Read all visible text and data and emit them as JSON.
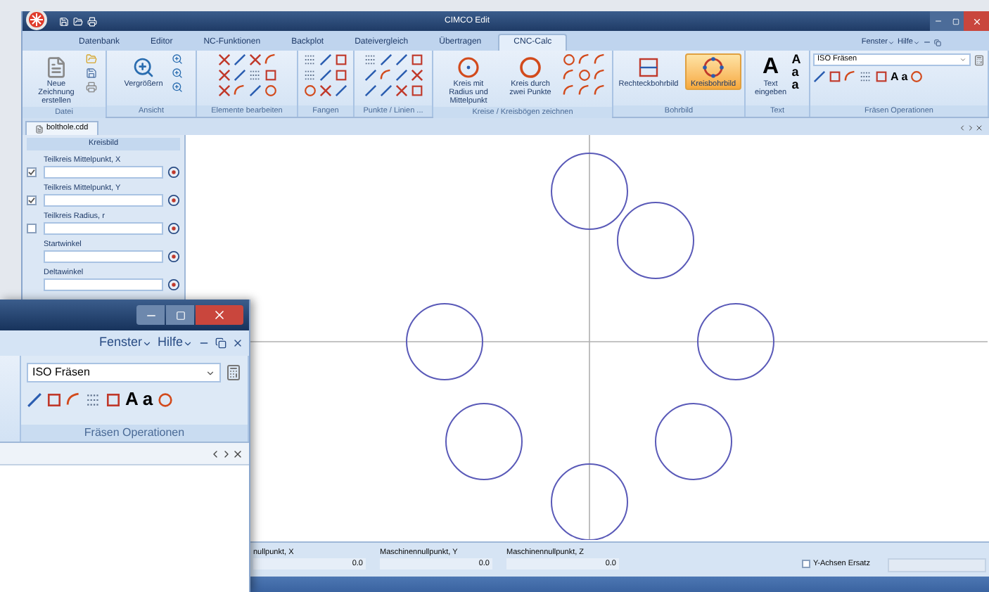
{
  "window": {
    "title": "CIMCO Edit"
  },
  "menu_tabs": [
    {
      "label": "Datenbank",
      "selected": false
    },
    {
      "label": "Editor",
      "selected": false
    },
    {
      "label": "NC-Funktionen",
      "selected": false
    },
    {
      "label": "Backplot",
      "selected": false
    },
    {
      "label": "Dateivergleich",
      "selected": false
    },
    {
      "label": "Übertragen",
      "selected": false
    },
    {
      "label": "CNC-Calc",
      "selected": true
    }
  ],
  "window_menu": [
    "Fenster",
    "Hilfe"
  ],
  "ribbon_groups": [
    {
      "label": "Datei",
      "buttons": [
        {
          "label": "Neue Zeichnung erstellen",
          "selected": false
        }
      ]
    },
    {
      "label": "Ansicht",
      "buttons": [
        {
          "label": "Vergrößern",
          "selected": false
        }
      ]
    },
    {
      "label": "Elemente bearbeiten"
    },
    {
      "label": "Fangen"
    },
    {
      "label": "Punkte / Linien ..."
    },
    {
      "label": "Kreise / Kreisbögen zeichnen",
      "buttons": [
        {
          "label": "Kreis mit Radius und Mittelpunkt",
          "selected": false
        },
        {
          "label": "Kreis durch zwei Punkte",
          "selected": false
        }
      ]
    },
    {
      "label": "Bohrbild",
      "buttons": [
        {
          "label": "Rechteckbohrbild",
          "selected": false
        },
        {
          "label": "Kreisbohrbild",
          "selected": true
        }
      ]
    },
    {
      "label": "Text",
      "buttons": [
        {
          "label": "Text eingeben",
          "selected": false
        }
      ]
    },
    {
      "label": "Fräsen Operationen"
    }
  ],
  "big_letters": [
    "A",
    "A",
    "a",
    "a"
  ],
  "milling": {
    "dropdown": "ISO Fräsen",
    "letters": [
      "A",
      "a"
    ]
  },
  "document_tab": "bolthole.cdd",
  "side_panel": {
    "title": "Kreisbild",
    "fields": [
      {
        "kind": "checkbox",
        "label": "Teilkreis Mittelpunkt, X",
        "checked": true
      },
      {
        "kind": "checkbox",
        "label": "Teilkreis Mittelpunkt, Y",
        "checked": true
      },
      {
        "kind": "checkbox",
        "label": "Teilkreis Radius, r",
        "checked": false
      },
      {
        "kind": "plain",
        "label": "Startwinkel"
      },
      {
        "kind": "plain",
        "label": "Deltawinkel"
      }
    ]
  },
  "bottom_panel": {
    "fields": [
      {
        "label": "nullpunkt, X",
        "value": "0.0"
      },
      {
        "label": "Maschinennullpunkt, Y",
        "value": "0.0"
      },
      {
        "label": "Maschinennullpunkt, Z",
        "value": "0.0"
      }
    ],
    "checkbox": {
      "label": "Y-Achsen Ersatz",
      "checked": false
    }
  },
  "inset": {
    "window_menu": [
      "Fenster",
      "Hilfe"
    ],
    "dropdown": "ISO Fräsen",
    "letters": [
      "A",
      "a"
    ],
    "group_label": "Fräsen Operationen"
  }
}
